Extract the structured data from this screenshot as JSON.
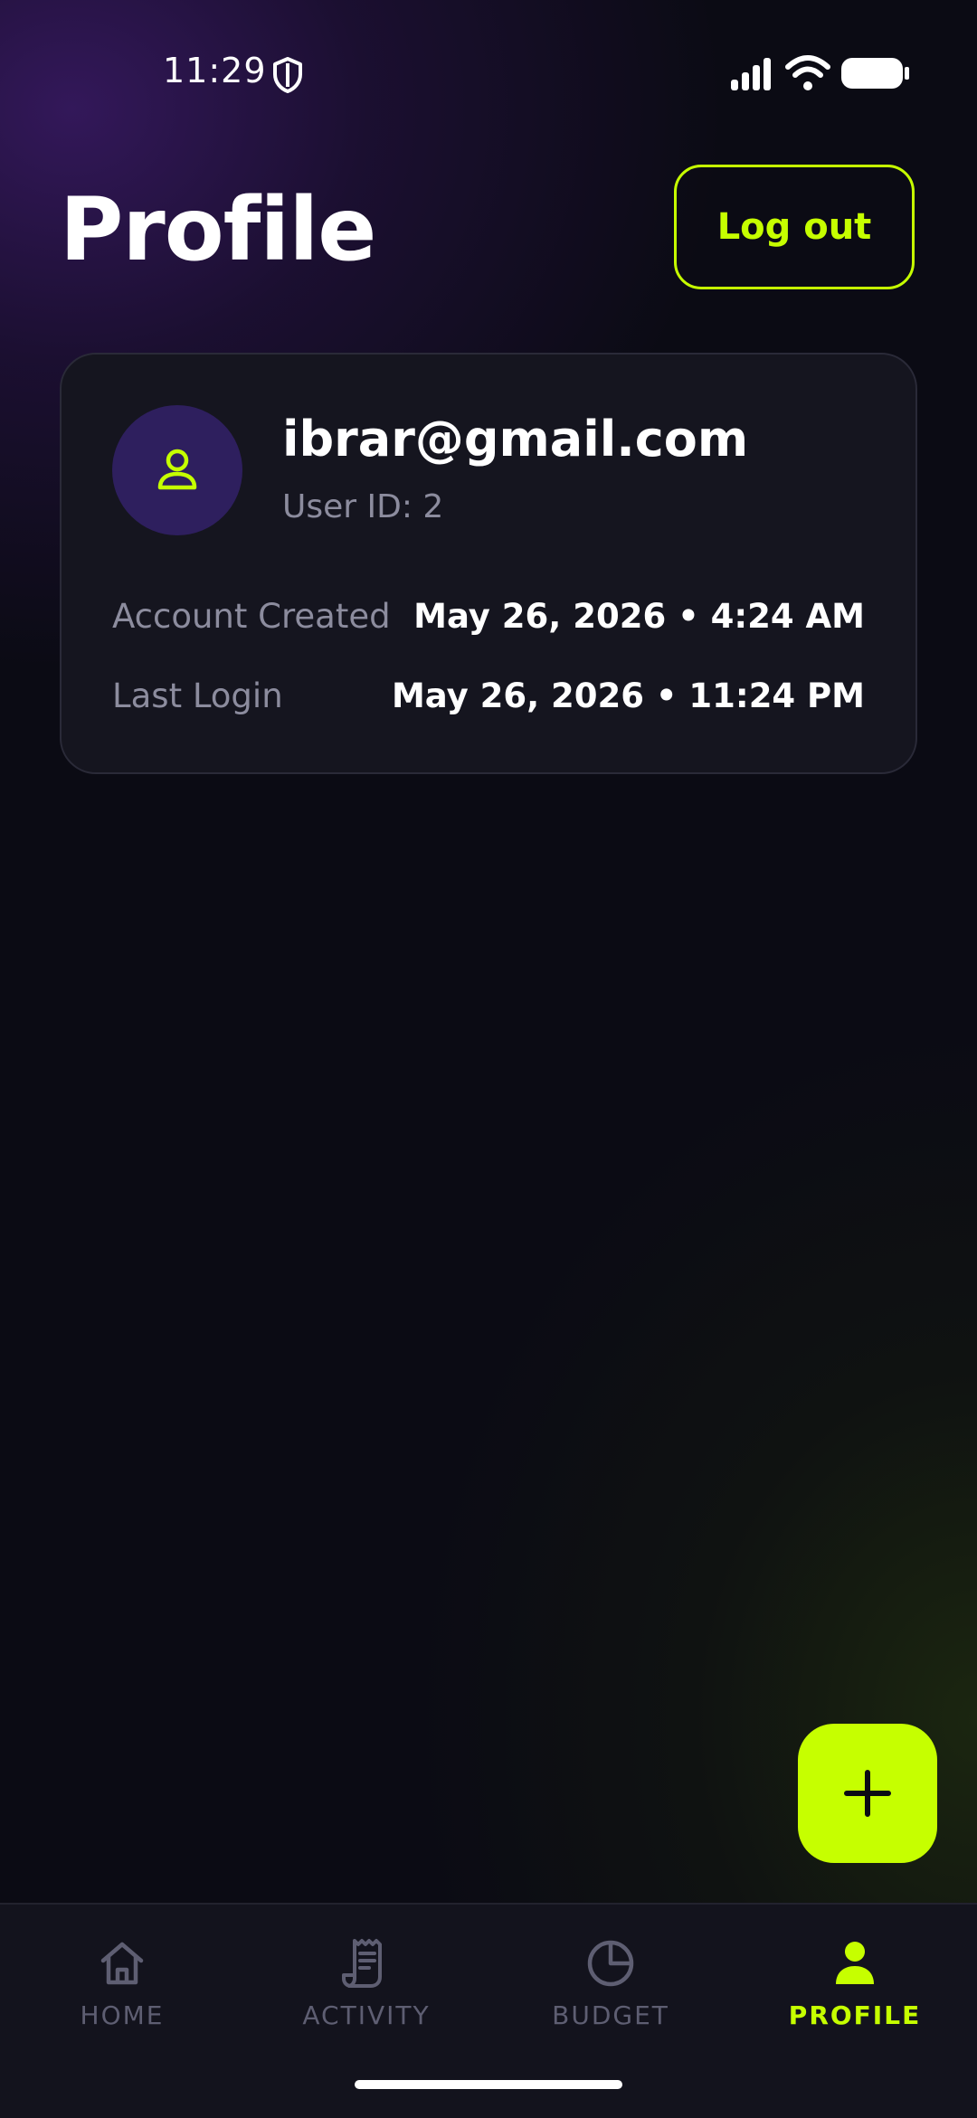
{
  "status_bar": {
    "time": "11:29",
    "icons": [
      "shield-icon",
      "signal-icon",
      "wifi-icon",
      "battery-icon"
    ]
  },
  "header": {
    "title": "Profile",
    "logout_label": "Log out"
  },
  "profile": {
    "email": "ibrar@gmail.com",
    "user_id": "User ID: 2",
    "avatar_icon": "user-icon",
    "rows": [
      {
        "label": "Account Created",
        "value": "May 26, 2026 • 4:24 AM"
      },
      {
        "label": "Last Login",
        "value": "May 26, 2026 • 11:24 PM"
      }
    ]
  },
  "fab": {
    "icon": "plus-icon"
  },
  "nav": {
    "items": [
      {
        "label": "HOME",
        "icon": "home-icon",
        "active": false
      },
      {
        "label": "ACTIVITY",
        "icon": "receipt-icon",
        "active": false
      },
      {
        "label": "BUDGET",
        "icon": "pie-chart-icon",
        "active": false
      },
      {
        "label": "PROFILE",
        "icon": "user-icon",
        "active": true
      }
    ]
  },
  "colors": {
    "accent": "#c6ff00",
    "background": "#0b0b14",
    "card": "#15151f",
    "avatar_bg": "#2e1f5e",
    "muted_text": "#8c8c9e",
    "nav_inactive": "#5e5e72"
  }
}
